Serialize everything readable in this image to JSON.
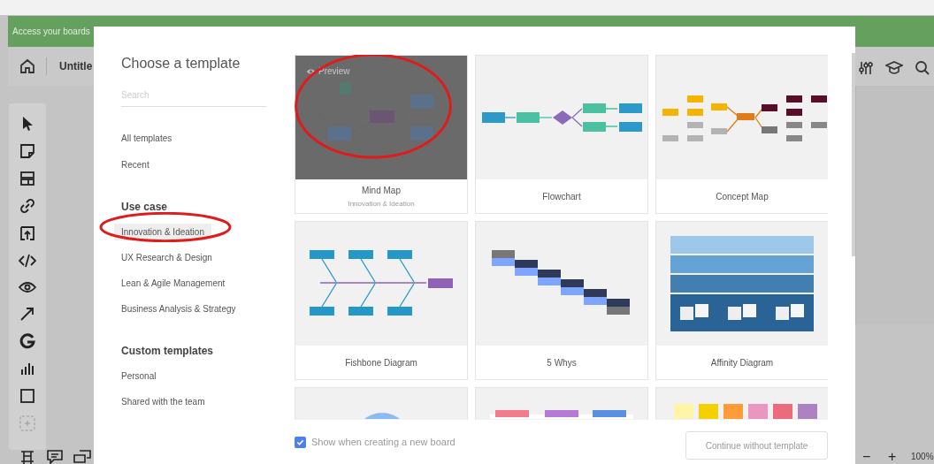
{
  "banner": {
    "text": "Access your boards"
  },
  "board": {
    "title": "Untitle"
  },
  "zoom": {
    "minus": "−",
    "plus": "+",
    "value": "100%"
  },
  "dialog": {
    "title": "Choose a template",
    "search": {
      "placeholder": "Search"
    },
    "nav": [
      {
        "label": "All templates",
        "selected": false
      },
      {
        "label": "Recent",
        "selected": false
      }
    ],
    "sections": [
      {
        "heading": "Use case",
        "items": [
          {
            "label": "Innovation & Ideation",
            "selected": true,
            "circled": true
          },
          {
            "label": "UX Research & Design",
            "selected": false,
            "circled": false
          },
          {
            "label": "Lean & Agile Management",
            "selected": false,
            "circled": false
          },
          {
            "label": "Business Analysis & Strategy",
            "selected": false,
            "circled": false
          }
        ]
      },
      {
        "heading": "Custom templates",
        "items": [
          {
            "label": "Personal",
            "selected": false,
            "circled": false
          },
          {
            "label": "Shared with the team",
            "selected": false,
            "circled": false
          }
        ]
      }
    ],
    "templates": [
      {
        "kind": "mind-map",
        "name": "Mind Map",
        "category": "Innovation & Ideation",
        "hovered": true,
        "preview": "Preview",
        "circled": true
      },
      {
        "kind": "flowchart",
        "name": "Flowchart",
        "hovered": false,
        "circled": false
      },
      {
        "kind": "concept-map",
        "name": "Concept Map",
        "hovered": false,
        "circled": false
      },
      {
        "kind": "fishbone",
        "name": "Fishbone Diagram",
        "hovered": false,
        "circled": false
      },
      {
        "kind": "five-whys",
        "name": "5 Whys",
        "hovered": false,
        "circled": false
      },
      {
        "kind": "affinity",
        "name": "Affinity Diagram",
        "hovered": false,
        "circled": false
      },
      {
        "kind": "circle",
        "hovered": false,
        "circled": false
      },
      {
        "kind": "kanban",
        "hovered": false,
        "circled": false
      },
      {
        "kind": "stickies",
        "hovered": false,
        "circled": false
      }
    ],
    "show_on_new_board": {
      "label": "Show when creating a new board",
      "checked": true
    },
    "continue_button": "Continue without template"
  }
}
